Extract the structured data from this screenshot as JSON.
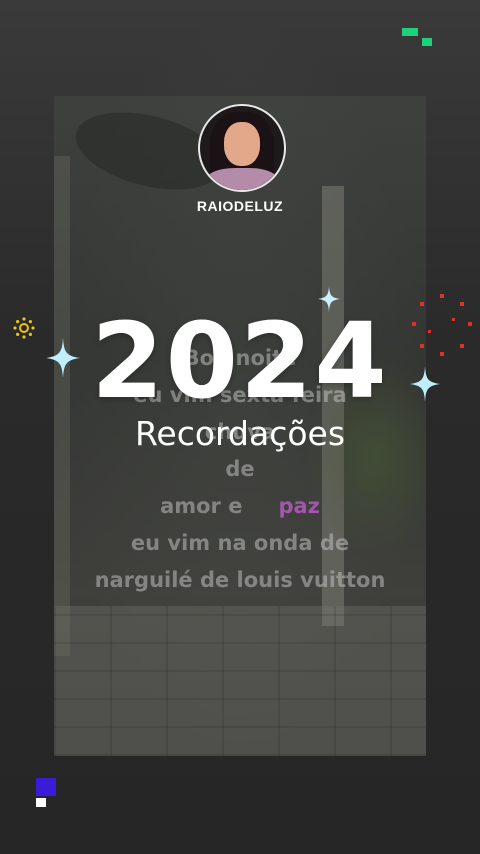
{
  "profile": {
    "username": "RAIODELUZ"
  },
  "lyrics": {
    "line1": "Boa noite",
    "line2": "eu vim sexta feira",
    "line3": "chuva",
    "line4": "de",
    "line5_a": "amor e",
    "line5_b": "paz",
    "line6": "eu vim na onda de",
    "line7": "narguilé de louis vuitton"
  },
  "recap": {
    "year": "2024",
    "subtitle": "Recordações"
  },
  "colors": {
    "logo_green": "#1ed27c",
    "mark_blue": "#3a1bd8",
    "sparkle_yellow": "#e8c21a",
    "sparkle_red": "#e0302a",
    "lyric_accent": "#be5ac8"
  }
}
